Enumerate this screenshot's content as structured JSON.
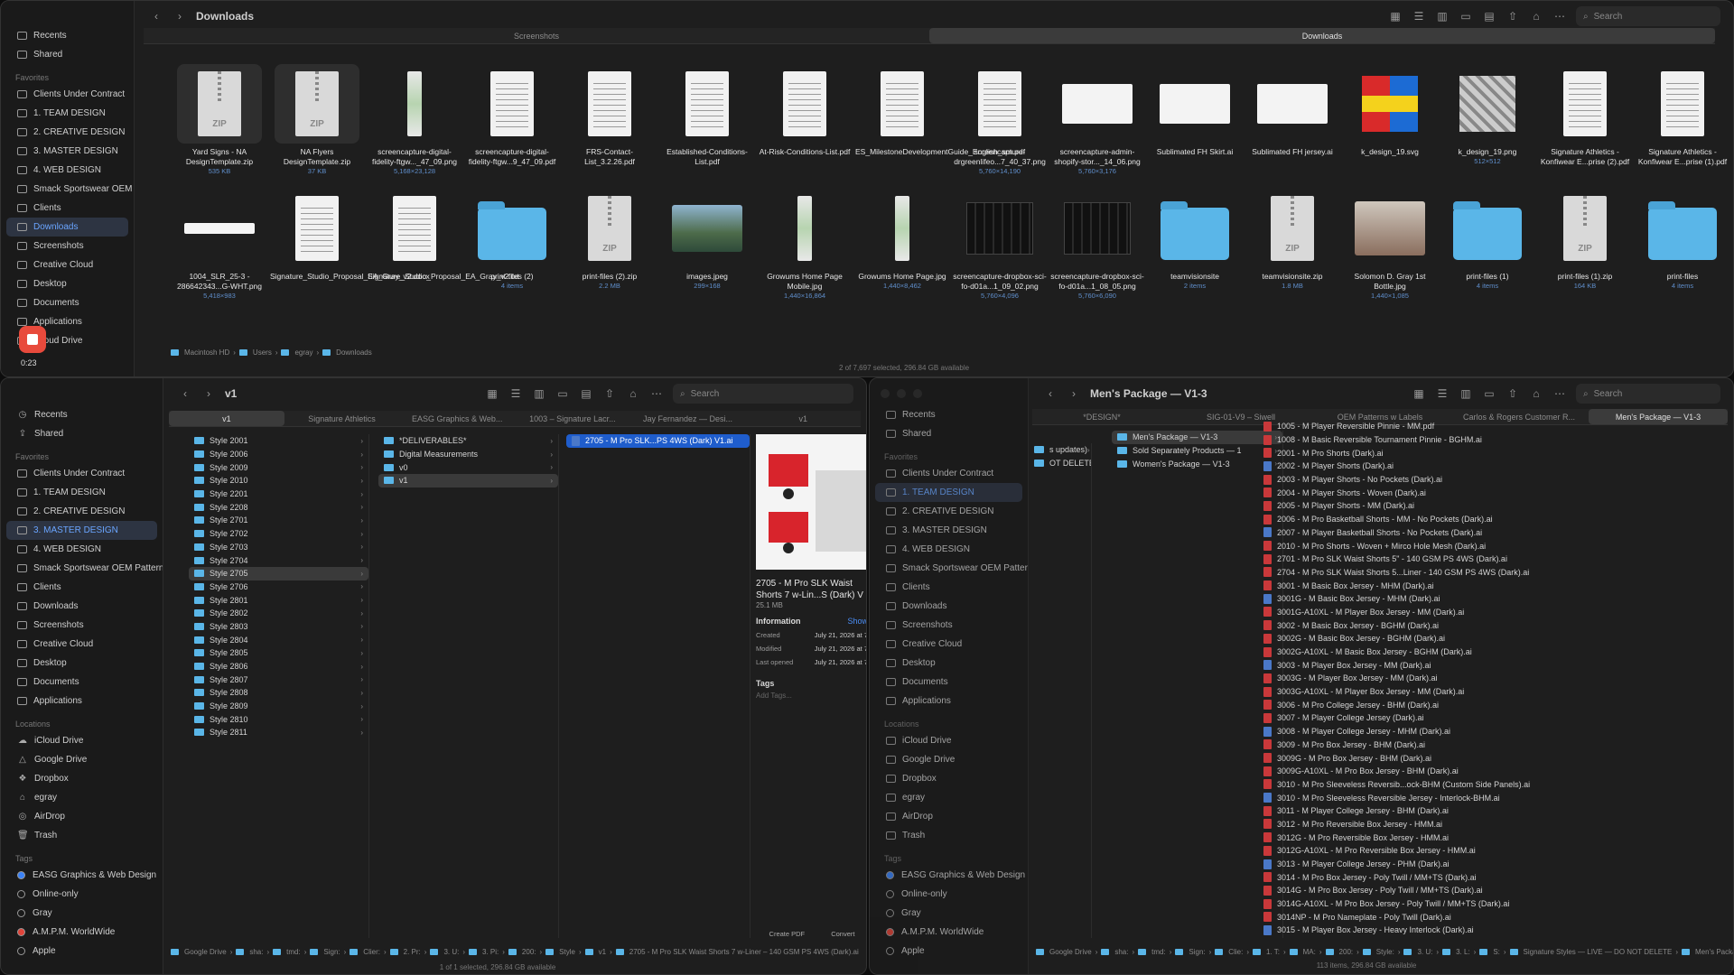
{
  "w1": {
    "title": "Downloads",
    "search": "Search",
    "tabs": [
      "Screenshots",
      "Downloads"
    ],
    "sidebar": [
      {
        "t": "Recents",
        "sec": 0
      },
      {
        "t": "Shared",
        "sec": 0
      },
      {
        "t": "Favorites",
        "sec": 1
      },
      {
        "t": "Clients Under Contract"
      },
      {
        "t": "1. TEAM DESIGN"
      },
      {
        "t": "2. CREATIVE DESIGN"
      },
      {
        "t": "3. MASTER DESIGN"
      },
      {
        "t": "4. WEB DESIGN"
      },
      {
        "t": "Smack Sportswear OEM Patterns"
      },
      {
        "t": "Clients"
      },
      {
        "t": "Downloads",
        "sel": 1
      },
      {
        "t": "Screenshots"
      },
      {
        "t": "Creative Cloud"
      },
      {
        "t": "Desktop"
      },
      {
        "t": "Documents"
      },
      {
        "t": "Applications"
      },
      {
        "t": "iCloud Drive"
      }
    ],
    "files": [
      {
        "n": "Yard Signs - NA DesignTemplate.zip",
        "m": "535 KB",
        "k": "zip",
        "s": 1
      },
      {
        "n": "NA Flyers DesignTemplate.zip",
        "m": "37 KB",
        "k": "zip",
        "s": 1
      },
      {
        "n": "screencapture-digital-fidelity-ftgw..._47_09.png",
        "m": "5,168×23,128",
        "k": "tall"
      },
      {
        "n": "screencapture-digital-fidelity-ftgw...9_47_09.pdf",
        "m": "",
        "k": "doc"
      },
      {
        "n": "FRS-Contact-List_3.2.26.pdf",
        "m": "",
        "k": "doc"
      },
      {
        "n": "Established-Conditions-List.pdf",
        "m": "",
        "k": "doc"
      },
      {
        "n": "At-Risk-Conditions-List.pdf",
        "m": "",
        "k": "doc"
      },
      {
        "n": "ES_MilestoneDevelopmentGuide_English_sm.pdf",
        "m": "",
        "k": "doc"
      },
      {
        "n": "screencapture-drgreenlifeo...7_40_37.png",
        "m": "5,760×14,190",
        "k": "doc"
      },
      {
        "n": "screencapture-admin-shopify-stor..._14_06.png",
        "m": "5,760×3,176",
        "k": "wide"
      },
      {
        "n": "Sublimated FH Skirt.ai",
        "m": "",
        "k": "wide"
      },
      {
        "n": "Sublimated FH jersey.ai",
        "m": "",
        "k": "wide"
      },
      {
        "n": "k_design_19.svg",
        "m": "",
        "k": "flag"
      },
      {
        "n": "k_design_19.png",
        "m": "512×512",
        "k": "gray"
      },
      {
        "n": "Signature Athletics - Konfiwear E...prise (2).pdf",
        "m": "",
        "k": "doc"
      },
      {
        "n": "Signature Athletics - Konfiwear E...prise (1).pdf",
        "m": "",
        "k": "doc"
      },
      {
        "n": "1004_SLR_25-3 - 286642343...G-WHT.png",
        "m": "5,418×983",
        "k": "strip"
      },
      {
        "n": "Signature_Studio_Proposal_EA_Gray_v2.docx",
        "m": "",
        "k": "doc"
      },
      {
        "n": "Signature_Studio_Proposal_EA_Gray_v2.txt",
        "m": "",
        "k": "doc"
      },
      {
        "n": "print-files (2)",
        "m": "4 items",
        "k": "folder"
      },
      {
        "n": "print-files (2).zip",
        "m": "2.2 MB",
        "k": "zip"
      },
      {
        "n": "images.jpeg",
        "m": "299×168",
        "k": "photo"
      },
      {
        "n": "Growums Home Page Mobile.jpg",
        "m": "1,440×16,864",
        "k": "tall"
      },
      {
        "n": "Growums Home Page.jpg",
        "m": "1,440×8,462",
        "k": "tall"
      },
      {
        "n": "screencapture-dropbox-sci-fo-d01a...1_09_02.png",
        "m": "5,760×4,096",
        "k": "dark"
      },
      {
        "n": "screencapture-dropbox-sci-fo-d01a...1_08_05.png",
        "m": "5,760×6,090",
        "k": "dark"
      },
      {
        "n": "teamvisionsite",
        "m": "2 items",
        "k": "folder"
      },
      {
        "n": "teamvisionsite.zip",
        "m": "1.8 MB",
        "k": "zip"
      },
      {
        "n": "Solomon D. Gray 1st Bottle.jpg",
        "m": "1,440×1,085",
        "k": "photo2"
      },
      {
        "n": "print-files (1)",
        "m": "4 items",
        "k": "folder"
      },
      {
        "n": "print-files (1).zip",
        "m": "164 KB",
        "k": "zip"
      },
      {
        "n": "print-files",
        "m": "4 items",
        "k": "folder"
      }
    ],
    "path": [
      "Macintosh HD",
      "Users",
      "egray",
      "Downloads"
    ],
    "status": "2 of 7,697 selected, 296.84 GB available"
  },
  "rec": {
    "time": "0:23"
  },
  "w2": {
    "title": "v1",
    "search": "Search",
    "tabs": [
      "v1",
      "Signature Athletics",
      "EASG Graphics & Web...",
      "1003 – Signature Lacr...",
      "Jay Fernandez — Desi...",
      "v1"
    ],
    "sidebar": [
      {
        "t": "Recents",
        "g": "◷"
      },
      {
        "t": "Shared",
        "g": "⇪"
      },
      {
        "t": "Favorites",
        "sec": 1
      },
      {
        "t": "Clients Under Contract"
      },
      {
        "t": "1. TEAM DESIGN"
      },
      {
        "t": "2. CREATIVE DESIGN"
      },
      {
        "t": "3. MASTER DESIGN",
        "sel": 1
      },
      {
        "t": "4. WEB DESIGN"
      },
      {
        "t": "Smack Sportswear OEM Patterns"
      },
      {
        "t": "Clients"
      },
      {
        "t": "Downloads"
      },
      {
        "t": "Screenshots"
      },
      {
        "t": "Creative Cloud"
      },
      {
        "t": "Desktop"
      },
      {
        "t": "Documents"
      },
      {
        "t": "Applications"
      },
      {
        "t": "Locations",
        "sec": 1
      },
      {
        "t": "iCloud Drive",
        "g": "☁"
      },
      {
        "t": "Google Drive",
        "g": "△"
      },
      {
        "t": "Dropbox",
        "g": "❖"
      },
      {
        "t": "egray",
        "g": "⌂"
      },
      {
        "t": "AirDrop",
        "g": "◎"
      },
      {
        "t": "Trash",
        "g": "🗑"
      },
      {
        "t": "Tags",
        "sec": 1
      },
      {
        "t": "EASG Graphics & Web Design",
        "d": "#3b82f6"
      },
      {
        "t": "Online-only",
        "d": "#1a1a1a"
      },
      {
        "t": "Gray",
        "d": "#1a1a1a"
      },
      {
        "t": "A.M.P.M. WorldWide",
        "d": "#e0443a"
      },
      {
        "t": "Apple",
        "d": "#1a1a1a"
      }
    ],
    "col1": [
      "Style 2001",
      "Style 2006",
      "Style 2009",
      "Style 2010",
      "Style 2201",
      "Style 2208",
      "Style 2701",
      "Style 2702",
      "Style 2703",
      "Style 2704",
      "Style 2705",
      "Style 2706",
      "Style 2801",
      "Style 2802",
      "Style 2803",
      "Style 2804",
      "Style 2805",
      "Style 2806",
      "Style 2807",
      "Style 2808",
      "Style 2809",
      "Style 2810",
      "Style 2811"
    ],
    "col2": [
      "*DELIVERABLES*",
      "Digital Measurements",
      "v0",
      "v1"
    ],
    "col3": "2705 - M Pro SLK...PS 4WS (Dark) V1.ai",
    "preview": {
      "name": "2705 - M Pro SLK Waist Shorts 7 w-Lin...S (Dark) V",
      "size": "25.1 MB",
      "info": "Information",
      "show": "Show",
      "created_l": "Created",
      "created": "July 21, 2026 at 7",
      "modified_l": "Modified",
      "modified": "July 21, 2026 at 7",
      "opened_l": "Last opened",
      "opened": "July 21, 2026 at 7",
      "tags": "Tags",
      "addtags": "Add Tags...",
      "a1": "Create PDF",
      "a2": "Convert"
    },
    "path": [
      "Google Drive",
      "sha:",
      "tmd:",
      "Sign:",
      "Clier:",
      "2. Pr:",
      "3. U:",
      "3. Pi:",
      "200:",
      "Style",
      "v1",
      "2705 - M Pro SLK Waist Shorts 7 w-Liner – 140 GSM PS 4WS (Dark).ai"
    ],
    "status": "1 of 1 selected, 296.84 GB available"
  },
  "w3": {
    "title": "Men's Package — V1-3",
    "search": "Search",
    "tabs": [
      "*DESIGN*",
      "SIG-01-V9 – Siwell",
      "OEM Patterns w Labels",
      "Carlos & Rogers Customer R...",
      "Men's Package — V1-3"
    ],
    "sidebar": [
      {
        "t": "Recents"
      },
      {
        "t": "Shared"
      },
      {
        "t": "Favorites",
        "sec": 1
      },
      {
        "t": "Clients Under Contract"
      },
      {
        "t": "1. TEAM DESIGN",
        "sel": 1
      },
      {
        "t": "2. CREATIVE DESIGN"
      },
      {
        "t": "3. MASTER DESIGN"
      },
      {
        "t": "4. WEB DESIGN"
      },
      {
        "t": "Smack Sportswear OEM Patterns"
      },
      {
        "t": "Clients"
      },
      {
        "t": "Downloads"
      },
      {
        "t": "Screenshots"
      },
      {
        "t": "Creative Cloud"
      },
      {
        "t": "Desktop"
      },
      {
        "t": "Documents"
      },
      {
        "t": "Applications"
      },
      {
        "t": "Locations",
        "sec": 1
      },
      {
        "t": "iCloud Drive"
      },
      {
        "t": "Google Drive"
      },
      {
        "t": "Dropbox"
      },
      {
        "t": "egray"
      },
      {
        "t": "AirDrop"
      },
      {
        "t": "Trash"
      },
      {
        "t": "Tags",
        "sec": 1
      },
      {
        "t": "EASG Graphics & Web Design",
        "d": "#3b82f6"
      },
      {
        "t": "Online-only",
        "d": "#1a1a1a"
      },
      {
        "t": "Gray",
        "d": "#1a1a1a"
      },
      {
        "t": "A.M.P.M. WorldWide",
        "d": "#e0443a"
      },
      {
        "t": "Apple",
        "d": "#1a1a1a"
      }
    ],
    "col0": [
      "s updates)",
      "OT DELETE"
    ],
    "col1": [
      "Men's Package — V1-3",
      "Sold Separately Products — 1",
      "Women's Package — V1-3"
    ],
    "col2": [
      "1005 - M Player Reversible Pinnie - MM.pdf",
      "1008 - M Basic Reversible Tournament Pinnie - BGHM.ai",
      "2001 - M Pro Shorts (Dark).ai",
      "2002 - M Player Shorts (Dark).ai",
      "2003 - M Player Shorts - No Pockets (Dark).ai",
      "2004 - M Player Shorts - Woven (Dark).ai",
      "2005 - M Player Shorts - MM (Dark).ai",
      "2006 - M Pro Basketball Shorts - MM - No Pockets (Dark).ai",
      "2007 - M Player Basketball Shorts - No Pockets (Dark).ai",
      "2010 - M Pro Shorts - Woven + Mirco Hole Mesh (Dark).ai",
      "2701 - M Pro SLK Waist Shorts 5\" - 140 GSM PS 4WS (Dark).ai",
      "2704 - M Pro SLK Waist Shorts 5...Liner - 140 GSM PS 4WS (Dark).ai",
      "3001 - M Basic Box Jersey - MHM (Dark).ai",
      "3001G - M Basic Box Jersey - MHM (Dark).ai",
      "3001G-A10XL - M Player Box Jersey - MM (Dark).ai",
      "3002 - M Basic Box Jersey - BGHM (Dark).ai",
      "3002G - M Basic Box Jersey - BGHM (Dark).ai",
      "3002G-A10XL - M Basic Box Jersey - BGHM (Dark).ai",
      "3003 - M Player Box Jersey - MM (Dark).ai",
      "3003G - M Player Box Jersey - MM (Dark).ai",
      "3003G-A10XL - M Player Box Jersey - MM (Dark).ai",
      "3006 - M Pro College Jersey - BHM (Dark).ai",
      "3007 - M Player College Jersey (Dark).ai",
      "3008 - M Player College Jersey - MHM (Dark).ai",
      "3009 - M Pro Box Jersey - BHM (Dark).ai",
      "3009G - M Pro Box Jersey - BHM (Dark).ai",
      "3009G-A10XL - M Pro Box Jersey - BHM (Dark).ai",
      "3010 - M Pro Sleeveless Reversib...ock-BHM (Custom Side Panels).ai",
      "3010 - M Pro Sleeveless Reversible Jersey - Interlock-BHM.ai",
      "3011 - M Player College Jersey - BHM (Dark).ai",
      "3012 - M Pro Reversible Box Jersey - HMM.ai",
      "3012G - M Pro Reversible Box Jersey - HMM.ai",
      "3012G-A10XL - M Pro Reversible Box Jersey - HMM.ai",
      "3013 - M Player College Jersey - PHM (Dark).ai",
      "3014 - M Pro Box Jersey - Poly Twill / MM+TS (Dark).ai",
      "3014G - M Pro Box Jersey - Poly Twill / MM+TS (Dark).ai",
      "3014G-A10XL - M Pro Box Jersey - Poly Twill / MM+TS (Dark).ai",
      "3014NP - M Pro Nameplate - Poly Twill (Dark).ai",
      "3015 - M Player Box Jersey - Heavy Interlock (Dark).ai"
    ],
    "path": [
      "Google Drive",
      "sha:",
      "tmd:",
      "Sign:",
      "Clie:",
      "1. T:",
      "MA:",
      "200:",
      "Style:",
      "3. U:",
      "3. L:",
      "S:",
      "Signature Styles — LIVE — DO NOT DELETE",
      "Men's Package — V1-3"
    ],
    "status": "113 items, 296.84 GB available"
  }
}
